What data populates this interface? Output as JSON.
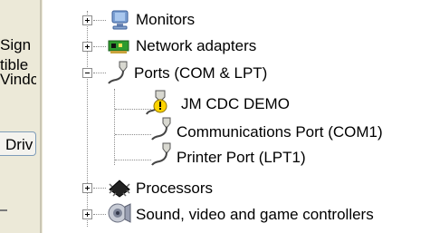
{
  "left_panel": {
    "fragments": [
      "Sign",
      "tible",
      "Vindc"
    ],
    "tab_label": "Driv"
  },
  "tree": {
    "items": [
      {
        "label": "Monitors",
        "icon": "monitor-icon",
        "expander": "plus"
      },
      {
        "label": "Network adapters",
        "icon": "network-adapter-icon",
        "expander": "plus"
      },
      {
        "label": "Ports (COM & LPT)",
        "icon": "port-connector-icon",
        "expander": "minus"
      },
      {
        "label": "JM CDC DEMO",
        "icon": "warning-port-icon",
        "child": true
      },
      {
        "label": "Communications Port (COM1)",
        "icon": "port-connector-icon",
        "child": true
      },
      {
        "label": "Printer Port (LPT1)",
        "icon": "port-connector-icon",
        "child": true
      },
      {
        "label": "Processors",
        "icon": "processor-icon",
        "expander": "plus"
      },
      {
        "label": "Sound, video and game controllers",
        "icon": "speaker-icon",
        "expander": "plus"
      }
    ]
  },
  "colors": {
    "panel_bg": "#ece9d8",
    "warning": "#ffd400",
    "network_green": "#2e9b2e"
  }
}
